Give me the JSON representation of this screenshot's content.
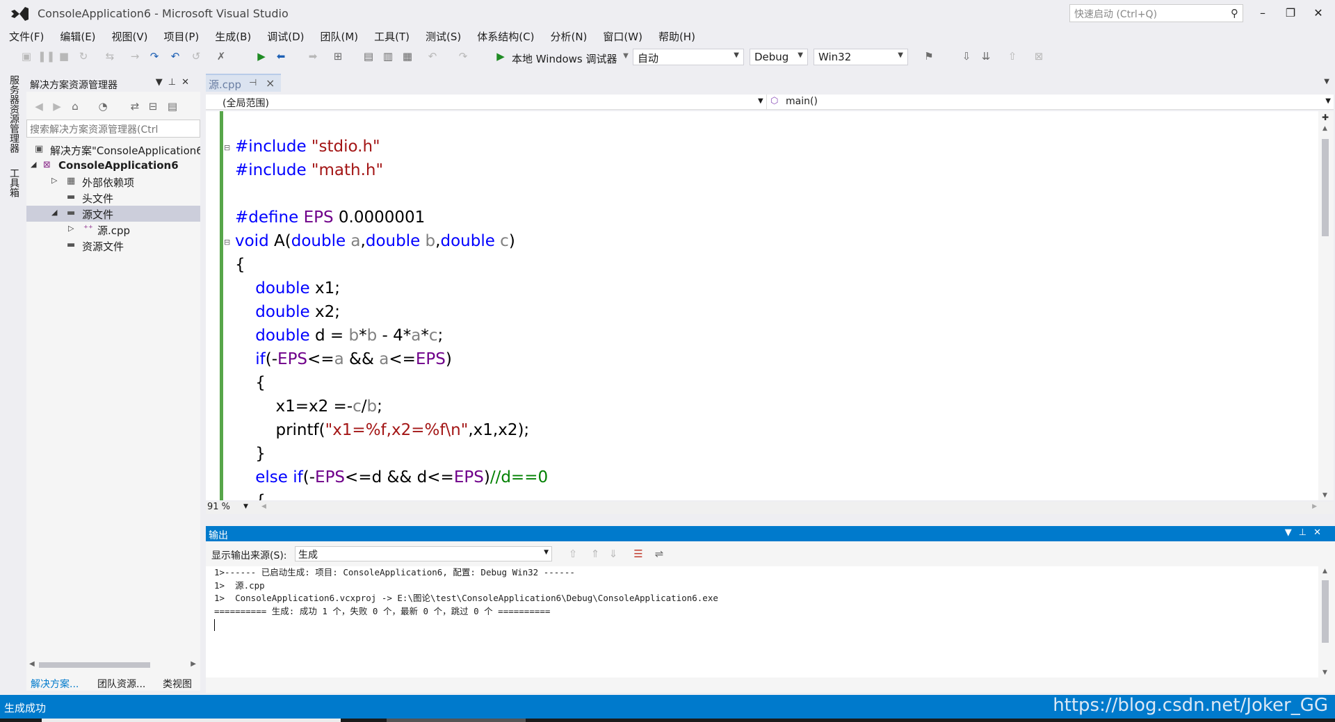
{
  "window": {
    "title": "ConsoleApplication6 - Microsoft Visual Studio",
    "quick_launch_placeholder": "快速启动 (Ctrl+Q)",
    "minimize": "–",
    "restore": "❐",
    "close": "✕"
  },
  "menu": [
    "文件(F)",
    "编辑(E)",
    "视图(V)",
    "项目(P)",
    "生成(B)",
    "调试(D)",
    "团队(M)",
    "工具(T)",
    "测试(S)",
    "体系结构(C)",
    "分析(N)",
    "窗口(W)",
    "帮助(H)"
  ],
  "toolbar": {
    "run_label": "本地 Windows 调试器",
    "solution_config_auto": "自动",
    "configuration": "Debug",
    "platform": "Win32"
  },
  "left_strip": {
    "server_explorer": "服务器资源管理器",
    "toolbox": "工具箱"
  },
  "solution_explorer": {
    "title": "解决方案资源管理器",
    "search_placeholder": "搜索解决方案资源管理器(Ctrl",
    "tree": [
      {
        "label": "解决方案\"ConsoleApplication6\"",
        "icon": "solution-icon",
        "bold": false
      },
      {
        "label": "ConsoleApplication6",
        "icon": "project-icon",
        "bold": true
      },
      {
        "label": "外部依赖项",
        "icon": "dependencies-icon",
        "bold": false
      },
      {
        "label": "头文件",
        "icon": "folder-icon",
        "bold": false
      },
      {
        "label": "源文件",
        "icon": "folder-icon",
        "bold": false
      },
      {
        "label": "源.cpp",
        "icon": "cpp-file-icon",
        "bold": false
      },
      {
        "label": "资源文件",
        "icon": "folder-icon",
        "bold": false
      }
    ],
    "tabs": [
      "解决方案...",
      "团队资源...",
      "类视图"
    ]
  },
  "editor": {
    "tab_label": "源.cpp",
    "scope": "(全局范围)",
    "function": "main()",
    "zoom": "91 %"
  },
  "output": {
    "title": "输出",
    "source_label": "显示输出来源(S):",
    "source_value": "生成",
    "lines": [
      "1>------ 已启动生成: 项目: ConsoleApplication6, 配置: Debug Win32 ------",
      "1>  源.cpp",
      "1>  ConsoleApplication6.vcxproj -> E:\\图论\\test\\ConsoleApplication6\\Debug\\ConsoleApplication6.exe",
      "========== 生成: 成功 1 个，失败 0 个，最新 0 个，跳过 0 个 =========="
    ]
  },
  "status": {
    "text": "生成成功",
    "watermark": "https://blog.csdn.net/Joker_GG"
  },
  "colors": {
    "accent": "#007acc",
    "keyword": "#0000ff",
    "string": "#a31515",
    "macro": "#6f008a",
    "comment": "#008000",
    "change_bar": "#57a64a"
  }
}
